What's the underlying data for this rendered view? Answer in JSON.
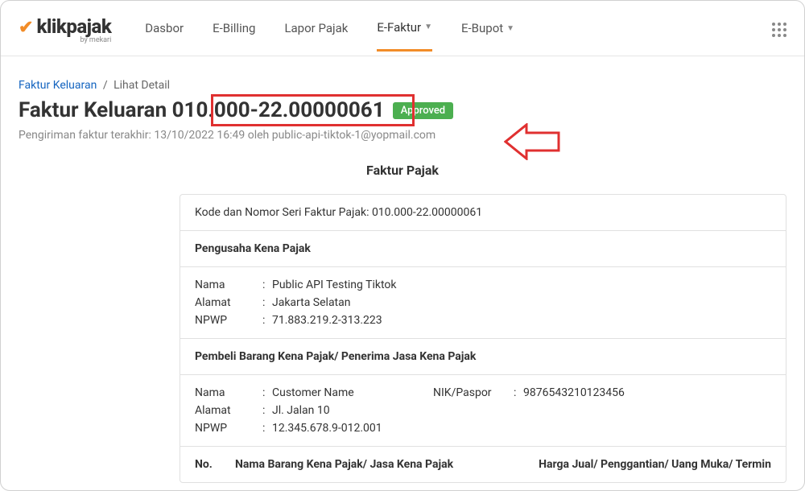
{
  "logo": {
    "brand": "klikpajak",
    "byline": "by mekari"
  },
  "nav": {
    "items": [
      {
        "label": "Dasbor",
        "dropdown": false,
        "active": false
      },
      {
        "label": "E-Billing",
        "dropdown": false,
        "active": false
      },
      {
        "label": "Lapor Pajak",
        "dropdown": false,
        "active": false
      },
      {
        "label": "E-Faktur",
        "dropdown": true,
        "active": true
      },
      {
        "label": "E-Bupot",
        "dropdown": true,
        "active": false
      }
    ]
  },
  "breadcrumb": {
    "parent": "Faktur Keluaran",
    "sep": "/",
    "current": "Lihat Detail"
  },
  "page": {
    "title": "Faktur Keluaran 010.000-22.00000061",
    "badge": "Approved",
    "subtitle": "Pengiriman faktur terakhir: 13/10/2022 16:49 oleh public-api-tiktok-1@yopmail.com"
  },
  "document": {
    "section_title": "Faktur Pajak",
    "kode_label": "Kode dan Nomor Seri Faktur Pajak:",
    "kode_value": "010.000-22.00000061",
    "pkp": {
      "header": "Pengusaha Kena Pajak",
      "nama_label": "Nama",
      "nama_value": "Public API Testing Tiktok",
      "alamat_label": "Alamat",
      "alamat_value": "Jakarta Selatan",
      "npwp_label": "NPWP",
      "npwp_value": "71.883.219.2-313.223"
    },
    "pembeli": {
      "header": "Pembeli Barang Kena Pajak/ Penerima Jasa Kena Pajak",
      "nama_label": "Nama",
      "nama_value": "Customer Name",
      "nik_label": "NIK/Paspor",
      "nik_value": "9876543210123456",
      "alamat_label": "Alamat",
      "alamat_value": "Jl. Jalan 10",
      "npwp_label": "NPWP",
      "npwp_value": "12.345.678.9-012.001"
    },
    "table": {
      "col_no": "No.",
      "col_nama": "Nama Barang Kena Pajak/ Jasa Kena Pajak",
      "col_harga": "Harga Jual/ Penggantian/ Uang Muka/ Termin"
    }
  }
}
